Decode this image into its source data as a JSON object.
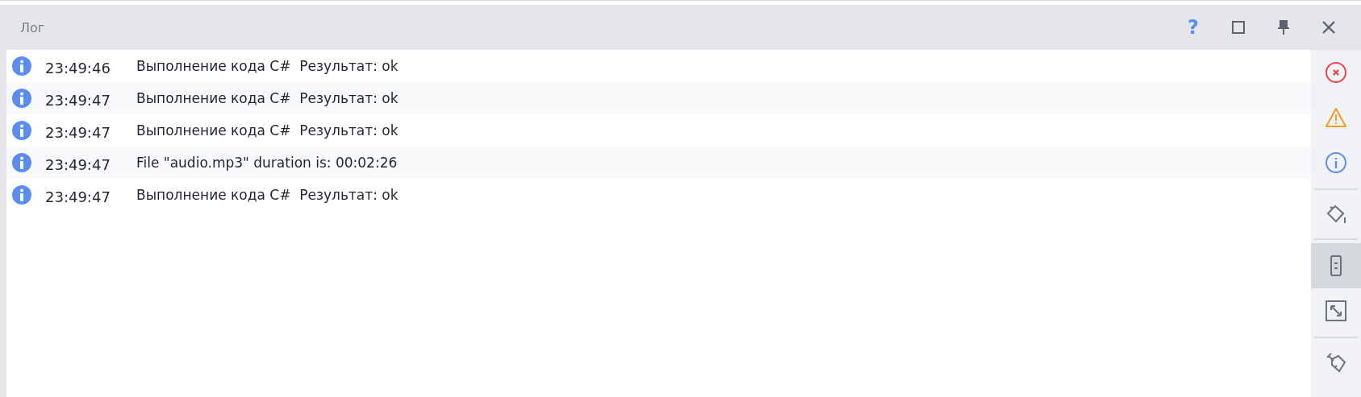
{
  "window": {
    "title": "Лог",
    "buttons": [
      {
        "kind": "help",
        "label": "?"
      },
      {
        "kind": "maximize"
      },
      {
        "kind": "pin"
      },
      {
        "kind": "close"
      }
    ]
  },
  "log": [
    {
      "kind": "info",
      "time": "23:49:46",
      "message": "Выполнение кода C#  Результат: ok"
    },
    {
      "kind": "info",
      "time": "23:49:47",
      "message": "Выполнение кода C#  Результат: ok"
    },
    {
      "kind": "info",
      "time": "23:49:47",
      "message": "Выполнение кода C#  Результат: ok"
    },
    {
      "kind": "info",
      "time": "23:49:47",
      "message": "File \"audio.mp3\" duration is: 00:02:26"
    },
    {
      "kind": "info",
      "time": "23:49:47",
      "message": "Выполнение кода C#  Результат: ok"
    }
  ],
  "sidebar": {
    "groups": [
      [
        {
          "kind": "error",
          "selected": false
        },
        {
          "kind": "warning",
          "selected": false
        },
        {
          "kind": "info",
          "selected": false
        }
      ],
      [
        {
          "kind": "tag",
          "selected": false
        }
      ],
      [
        {
          "kind": "wrap",
          "selected": true
        },
        {
          "kind": "expand",
          "selected": false
        }
      ],
      [
        {
          "kind": "clear",
          "selected": false
        }
      ]
    ]
  }
}
